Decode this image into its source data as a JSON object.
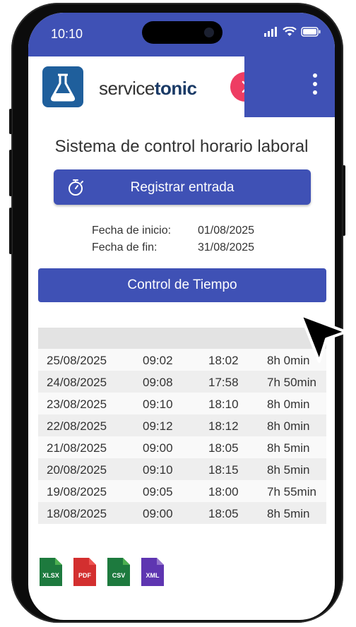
{
  "status": {
    "time": "10:10"
  },
  "header": {
    "brand_light": "service",
    "brand_bold": "tonic"
  },
  "page": {
    "title": "Sistema de control horario laboral"
  },
  "register_button": {
    "label": "Registrar entrada"
  },
  "period": {
    "start_label": "Fecha de inicio:",
    "start_value": "01/08/2025",
    "end_label": "Fecha de fin:",
    "end_value": "31/08/2025"
  },
  "control_button": {
    "label": "Control de Tiempo"
  },
  "table": {
    "rows": [
      [
        "25/08/2025",
        "09:02",
        "18:02",
        "8h 0min"
      ],
      [
        "24/08/2025",
        "09:08",
        "17:58",
        "7h 50min"
      ],
      [
        "23/08/2025",
        "09:10",
        "18:10",
        "8h 0min"
      ],
      [
        "22/08/2025",
        "09:12",
        "18:12",
        "8h 0min"
      ],
      [
        "21/08/2025",
        "09:00",
        "18:05",
        "8h 5min"
      ],
      [
        "20/08/2025",
        "09:10",
        "18:15",
        "8h 5min"
      ],
      [
        "19/08/2025",
        "09:05",
        "18:00",
        "7h 55min"
      ],
      [
        "18/08/2025",
        "09:00",
        "18:05",
        "8h 5min"
      ]
    ]
  },
  "exports": [
    {
      "label": "XLSX",
      "color": "#1d7a3e",
      "icon": "xlsx-file-icon"
    },
    {
      "label": "PDF",
      "color": "#d32f2f",
      "icon": "pdf-file-icon"
    },
    {
      "label": "CSV",
      "color": "#1d7a3e",
      "icon": "csv-file-icon"
    },
    {
      "label": "XML",
      "color": "#5e35b1",
      "icon": "xml-file-icon"
    }
  ],
  "colors": {
    "primary": "#3f51b5",
    "accent": "#ee3d63",
    "logo": "#1f5f9c"
  }
}
